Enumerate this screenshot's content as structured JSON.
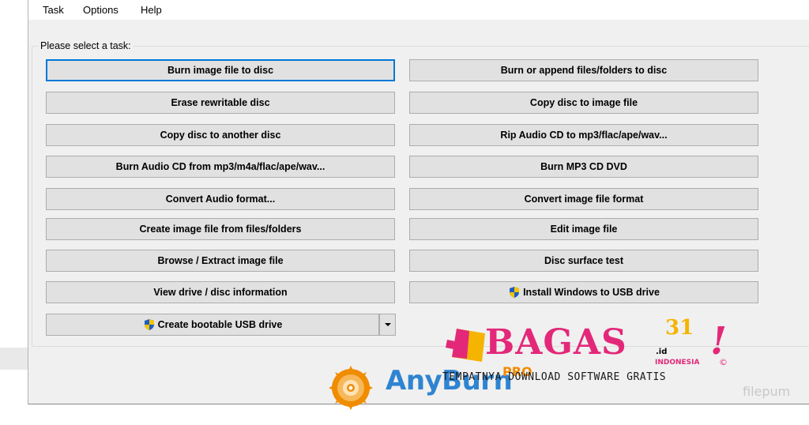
{
  "menu": [
    "Task",
    "Options",
    "Help"
  ],
  "group_label": "Please select a task:",
  "buttons_left": [
    "Burn image file to disc",
    "Erase rewritable disc",
    "Copy disc to another disc",
    "Burn Audio CD from mp3/m4a/flac/ape/wav...",
    "Convert Audio format...",
    "Create image file from files/folders",
    "Browse / Extract image file",
    "View drive / disc information",
    "Create bootable USB drive"
  ],
  "buttons_right": [
    "Burn or append files/folders to disc",
    "Copy disc to image file",
    "Rip Audio CD to mp3/flac/ape/wav...",
    "Burn MP3 CD DVD",
    "Convert image file format",
    "Edit image file",
    "Disc surface test",
    "Install Windows to USB drive"
  ],
  "focused_button": "Burn image file to disc",
  "shield_icon": "uac-shield-icon",
  "watermark": {
    "anyburn_name": "AnyBurn",
    "anyburn_edition": "PRO",
    "bagas_name": "BAGAS",
    "bagas_number": "31",
    "bagas_tld": ".id",
    "bagas_country": "INDONESIA",
    "bagas_mark": "!",
    "bagas_copyright": "©",
    "bagas_tagline": "TEMPATNYA DOWNLOAD SOFTWARE GRATIS",
    "filepuma": "filepum"
  },
  "colors": {
    "focus_border": "#0078d7",
    "button_face": "#e1e1e1",
    "window_bg": "#f0f0f0",
    "anyburn_blue": "#2f84d1",
    "bagas_pink": "#e32879"
  }
}
